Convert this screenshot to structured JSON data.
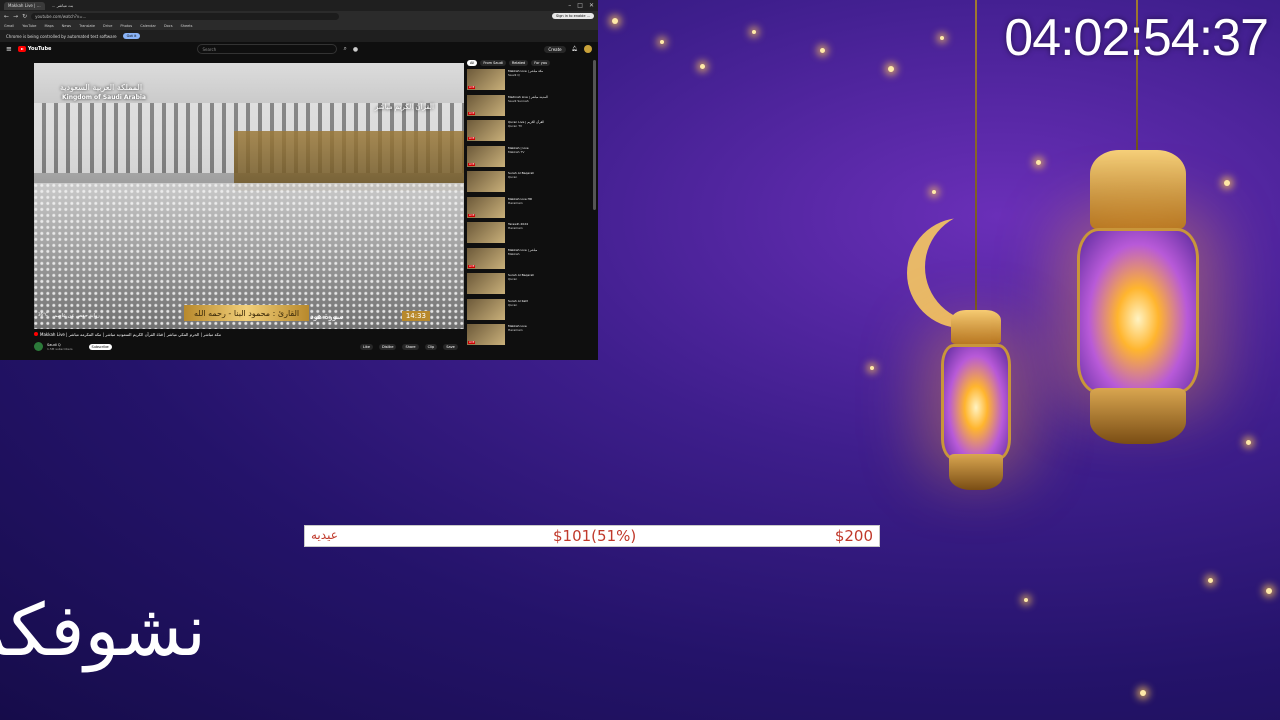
{
  "timer": "04:02:54:37",
  "browser": {
    "tabs": [
      {
        "label": "Makkah Live | ..."
      },
      {
        "label": "... بث مباشر"
      }
    ],
    "url": "youtube.com/watch?v=...",
    "profile_label": "Sign in to enable ...",
    "bookmarks": [
      "Gmail",
      "YouTube",
      "Maps",
      "News",
      "Translate",
      "Drive",
      "Photos",
      "Calendar",
      "Docs",
      "Sheets"
    ],
    "infobar_message": "Chrome is being controlled by automated test software",
    "infobar_button": "Got it"
  },
  "youtube": {
    "logo": "YouTube",
    "search_placeholder": "Search",
    "create_label": "Create",
    "player": {
      "title_ar": "المملكة العربية السعودية",
      "title_en": "Kingdom of Saudi Arabia",
      "channel_logo": "القرآن الكريم مباشر",
      "reader": "القارئ : محمود البنا - رحمه الله",
      "surah": "سورة هود",
      "time": "14:33",
      "date": "رواية حفص عن عاصم",
      "temp": "36°C"
    },
    "video_title": "Makkah Live | مكة مباشر | الحرم المكي مباشر | قناة القرآن الكريم السعودية مباشر | مكه المكرمه مباشر",
    "channel_name": "Saudi Q",
    "channel_subs": "1.5M subscribers",
    "subscribe_label": "Subscribe",
    "actions": [
      "Like",
      "Dislike",
      "Share",
      "Clip",
      "Save"
    ],
    "chips": [
      "All",
      "From Saudi",
      "Related",
      "For you"
    ],
    "recommendations": [
      {
        "title": "Makkah Live | مكة مباشر",
        "channel": "Saudi Q",
        "live": "LIVE"
      },
      {
        "title": "Madinah Live | المدينة مباشر",
        "channel": "Saudi Sunnah",
        "live": "LIVE"
      },
      {
        "title": "Quran Live | القرآن الكريم",
        "channel": "Quran TV",
        "live": "LIVE"
      },
      {
        "title": "Makkah | Live",
        "channel": "Makkah TV",
        "live": "LIVE"
      },
      {
        "title": "Surah Al Baqarah",
        "channel": "Quran",
        "live": ""
      },
      {
        "title": "Makkah Live HD",
        "channel": "Haramain",
        "live": "LIVE"
      },
      {
        "title": "Tarawih 2024",
        "channel": "Haramain",
        "live": ""
      },
      {
        "title": "Makkah Live | مباشر",
        "channel": "Makkah",
        "live": "LIVE"
      },
      {
        "title": "Surah Al Baqarah",
        "channel": "Quran",
        "live": ""
      },
      {
        "title": "Surah Al Kahf",
        "channel": "Quran",
        "live": ""
      },
      {
        "title": "Makkah Live",
        "channel": "Haramain",
        "live": "LIVE"
      }
    ]
  },
  "goal": {
    "label": "عيديه",
    "current": "$101(51%)",
    "target": "$200",
    "fraction": 0.51,
    "text_color": "#c0392b"
  },
  "marquee_text": "نشوفكم"
}
